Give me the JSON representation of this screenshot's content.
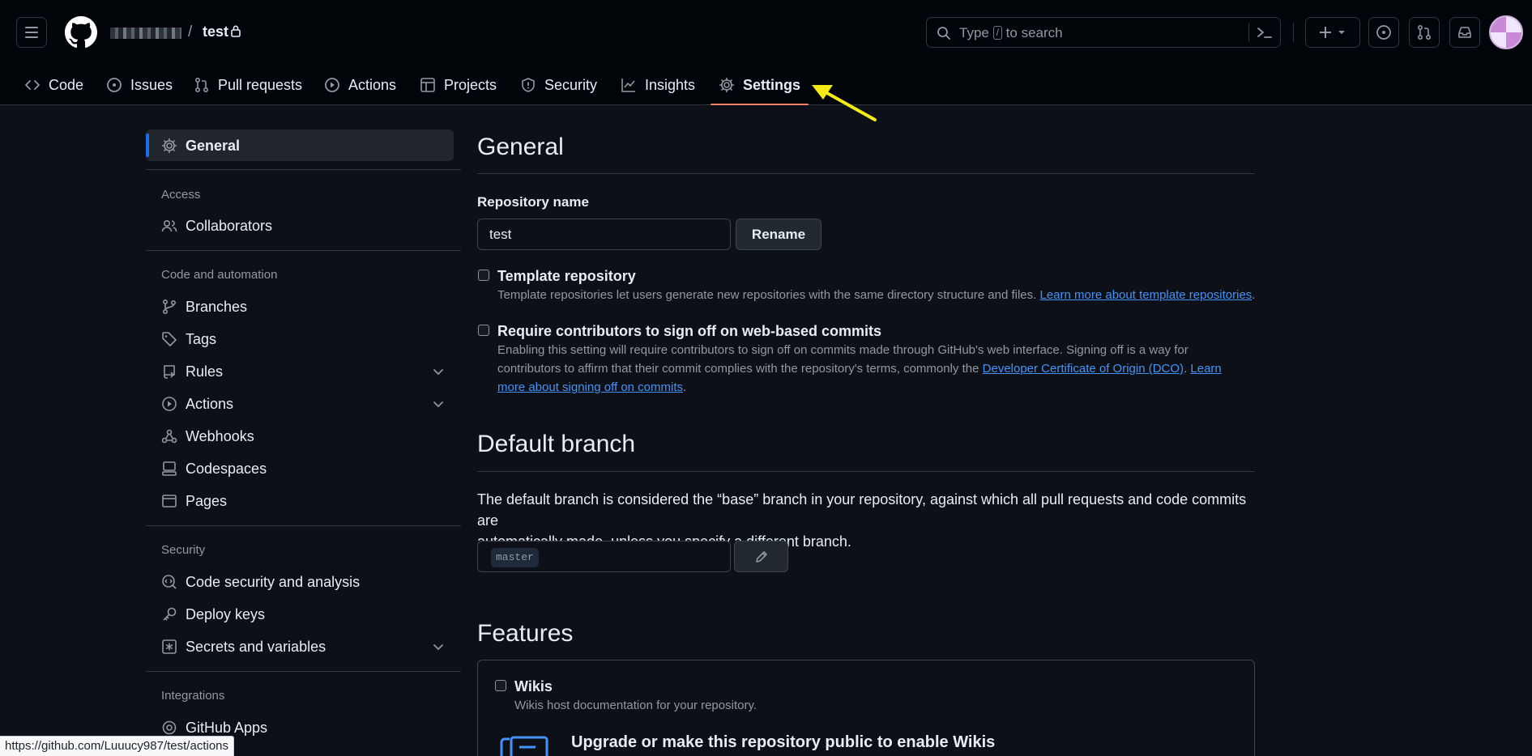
{
  "header": {
    "repo": "test",
    "slash": "/",
    "search": {
      "before": "Type",
      "key": "/",
      "after": "to search"
    }
  },
  "tabs": [
    {
      "label": "Code"
    },
    {
      "label": "Issues"
    },
    {
      "label": "Pull requests"
    },
    {
      "label": "Actions"
    },
    {
      "label": "Projects"
    },
    {
      "label": "Security"
    },
    {
      "label": "Insights"
    },
    {
      "label": "Settings",
      "active": true
    }
  ],
  "sidebar": {
    "general": "General",
    "access_heading": "Access",
    "collaborators": "Collaborators",
    "code_heading": "Code and automation",
    "branches": "Branches",
    "tags": "Tags",
    "rules": "Rules",
    "actions": "Actions",
    "webhooks": "Webhooks",
    "codespaces": "Codespaces",
    "pages": "Pages",
    "security_heading": "Security",
    "code_security": "Code security and analysis",
    "deploy_keys": "Deploy keys",
    "secrets": "Secrets and variables",
    "integrations_heading": "Integrations",
    "github_apps": "GitHub Apps"
  },
  "main": {
    "title": "General",
    "repo_name_label": "Repository name",
    "repo_name_value": "test",
    "rename_label": "Rename",
    "template": {
      "title": "Template repository",
      "desc": "Template repositories let users generate new repositories with the same directory structure and files.",
      "link": "Learn more about template repositories",
      "end": "."
    },
    "signoff": {
      "title": "Require contributors to sign off on web-based commits",
      "line1": "Enabling this setting will require contributors to sign off on commits made through GitHub's web interface. Signing off is a way for",
      "line2": "contributors to affirm that their commit complies with the repository's terms, commonly the",
      "link1": "Developer Certificate of Origin (DCO)",
      "mid": ".",
      "link2a": "Learn",
      "link2b": "more about signing off on commits",
      "end": "."
    },
    "default_branch": {
      "title": "Default branch",
      "line1": "The default branch is considered the “base” branch in your repository, against which all pull requests and code commits are",
      "line2": "automatically made, unless you specify a different branch.",
      "branch": "master"
    },
    "features": {
      "title": "Features",
      "wikis_title": "Wikis",
      "wikis_desc": "Wikis host documentation for your repository.",
      "upgrade": "Upgrade or make this repository public to enable Wikis"
    }
  },
  "statusbar": "https://github.com/Luuucy987/test/actions",
  "colors": {
    "background": "#0d1117",
    "header": "#010409",
    "accent_underline": "#f78166",
    "link": "#4493f8",
    "arrow": "#f5ea14"
  }
}
